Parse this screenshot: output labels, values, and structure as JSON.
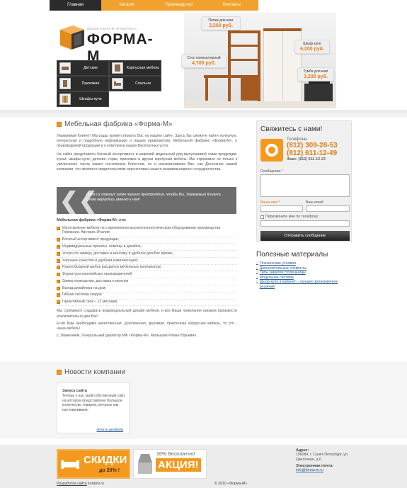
{
  "nav": {
    "items": [
      {
        "label": "Главная",
        "active": true
      },
      {
        "label": "Каталог",
        "active": false
      },
      {
        "label": "Производство",
        "active": false
      },
      {
        "label": "Контакты",
        "active": false
      }
    ]
  },
  "logo": {
    "subtitle": "МЕБЕЛЬНАЯ ФАБРИКА",
    "name": "ФОРМА-М"
  },
  "categories": [
    {
      "label": "Детские"
    },
    {
      "label": "Корпусная мебель"
    },
    {
      "label": "Прихожие"
    },
    {
      "label": "Спальни"
    },
    {
      "label": "Шкафы-купе"
    }
  ],
  "hero_prices": [
    {
      "name": "Полка для книг",
      "price": "3,200 руб."
    },
    {
      "name": "Стол компьютерный",
      "price": "4,700 руб."
    },
    {
      "name": "Шкаф купе",
      "price": "6,200 руб."
    },
    {
      "name": "Тумба для книг",
      "price": "3,200 руб."
    }
  ],
  "main": {
    "title": "Мебельная фабрика «Форма-М»",
    "p1": "Уважаемый Клиент! Мы рады приветствовать Вас на нашем сайте. Здесь Вы сможете найти полезную, интересную и подробную информацию о нашем предприятии, Мебельной фабрике «Форма-М», о производимой продукции и о комплексе наших Бесплатных услуг.",
    "p2": "На сайте представлен богатый ассортимент и широкий модельный ряд выпускаемой нами продукции: кухни, шкафы-купе, детские, горки, прихожие и другая корпусная мебель. Мы стремимся не только к увеличению числа наших постоянных Клиентов, но и рассматриваем Вас, как Достояние нашей компании, что является свидетельством перспективы нашего взаимовыгодного сотрудничества.",
    "quote": "Одна из главных задач нашего предприятия, чтобы Вы, Уважаемый Клиент, снова вернулись именно к нам!",
    "features_title": "Мебельная фабрика «Форма-М» это:",
    "features": [
      "Изготовление мебели на современном высокотехнологическом оборудовании производства Германии, Австрии, Италии;",
      "Богатый ассортимент продукции;",
      "Индивидуальные проекты, помощь в дизайне;",
      "Услуги по замеру, доставке и монтажу в удобное для Вас время;",
      "Хорошее качество и удобная комплектация;",
      "Разнообразный выбор расцветок мебельных материалов;",
      "Фурнитура европейских производителей;",
      "Замер помещения, доставка и монтаж",
      "Выезд дизайнера на дом;",
      "Гибкая система скидок;",
      "Гарантийный срок – 12 месяцев."
    ],
    "p3": "Мы стремимся создавать индивидуальный дизайн мебели, и все Ваши пожелания сможем произвести исключительно для Вас!",
    "p4": "Если Вам необходима качественная, долговечная, красивая, практичная корпусная мебель, то это - наша мебель!",
    "p5": "С Уважением, Генеральный директор МФ «Форма-М», Малышев Роман Юрьевич."
  },
  "contact": {
    "title": "Свяжитесь с нами!",
    "phones_label": "Телефоны",
    "phone1": "(812) 309-28-53",
    "phone2": "(812) 611-12-49",
    "fax": "Факс: (812) 611-12-23",
    "message_label": "Сообщение:",
    "name_label": "Ваше имя:",
    "email_label": "Ваш email:",
    "callback_label": "Перезвоните мне по телефону:",
    "send_label": "Отправить сообщение"
  },
  "useful": {
    "title": "Полезные материалы",
    "links": [
      "Технические условия",
      "Дополнительные элементы",
      "Типы завалов столешницы",
      "Модульная система",
      "Шкаф-купе в кабинет – лучшее эргономичное решение"
    ]
  },
  "news": {
    "title": "Новости компании",
    "item_title": "Запуск сайта",
    "item_body": "Теперь у нас свой собственный сайт, на котором представлено большое количество товаров, которые мы изготавливаем.",
    "read_more": "читать целиком"
  },
  "footer": {
    "promo1_big": "СКИДКИ",
    "promo1_small": "до 20% !",
    "promo2_small": "10% бесплатно!",
    "promo2_big": "АКЦИЯ!",
    "address_label": "Адрес:",
    "address": "196084, г. Санкт-Петербург, ул. Цветочная, д.6",
    "email_label": "Электронная почта:",
    "email": "info@forma-m.ru",
    "dev_link": "Разработка сайта",
    "dev_name": "kuratov.ru",
    "copyright": "© 2010 «Форма-М»"
  },
  "colors": {
    "accent": "#f39a1e",
    "dark": "#2b2b2b",
    "link": "#2c5e93"
  }
}
